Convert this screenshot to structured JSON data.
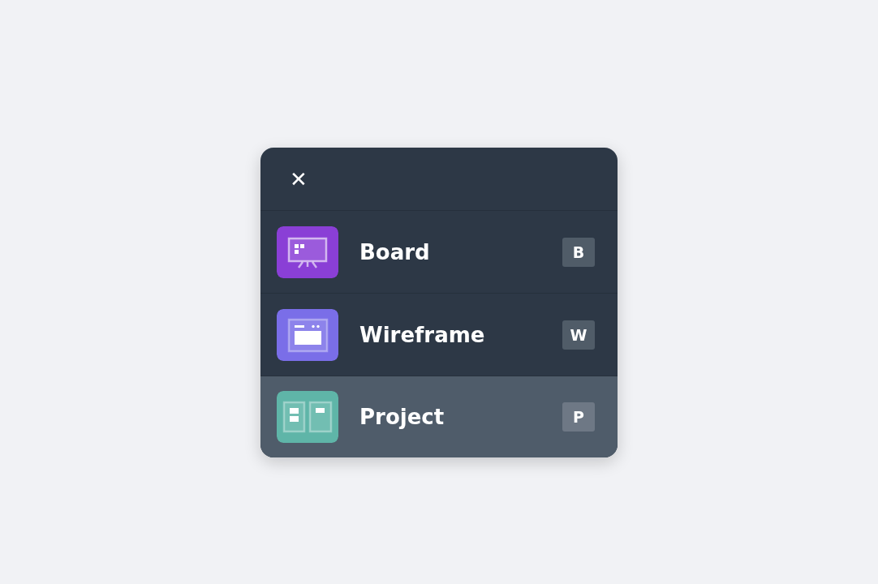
{
  "close_button": {
    "label": "✕"
  },
  "items": [
    {
      "label": "Board",
      "shortcut": "B",
      "kind": "board",
      "color": "#8a3fd6",
      "selected": false
    },
    {
      "label": "Wireframe",
      "shortcut": "W",
      "kind": "wireframe",
      "color": "#7a6ee8",
      "selected": false
    },
    {
      "label": "Project",
      "shortcut": "P",
      "kind": "project",
      "color": "#5fb5a8",
      "selected": true
    }
  ]
}
